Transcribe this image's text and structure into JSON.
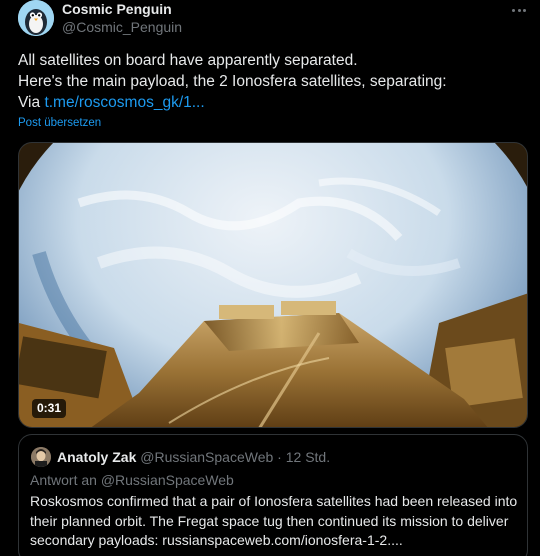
{
  "author": {
    "name": "Cosmic Penguin",
    "handle": "@Cosmic_Penguin"
  },
  "tweet": {
    "lines": [
      "All satellites on board have apparently separated.",
      "Here's the main payload, the 2 Ionosfera satellites, separating:"
    ],
    "via_prefix": "Via ",
    "link": "t.me/roscosmos_gk/1...",
    "translate_label": "Post übersetzen"
  },
  "media": {
    "duration": "0:31"
  },
  "quote": {
    "name": "Anatoly Zak",
    "handle": "@RussianSpaceWeb",
    "separator": " · ",
    "time": "12 Std.",
    "reply_to": "Antwort an @RussianSpaceWeb",
    "text": "Roskosmos confirmed that a pair of Ionosfera satellites had been released into their planned orbit. The Fregat space tug then continued its mission to deliver secondary payloads: russianspaceweb.com/ionosfera-1-2...."
  },
  "icons": {
    "more": "more-horizontal-icon"
  },
  "colors": {
    "background": "#000000",
    "text": "#e7e9ea",
    "muted": "#71767b",
    "link": "#1d9bf0",
    "border": "#2f3336"
  }
}
